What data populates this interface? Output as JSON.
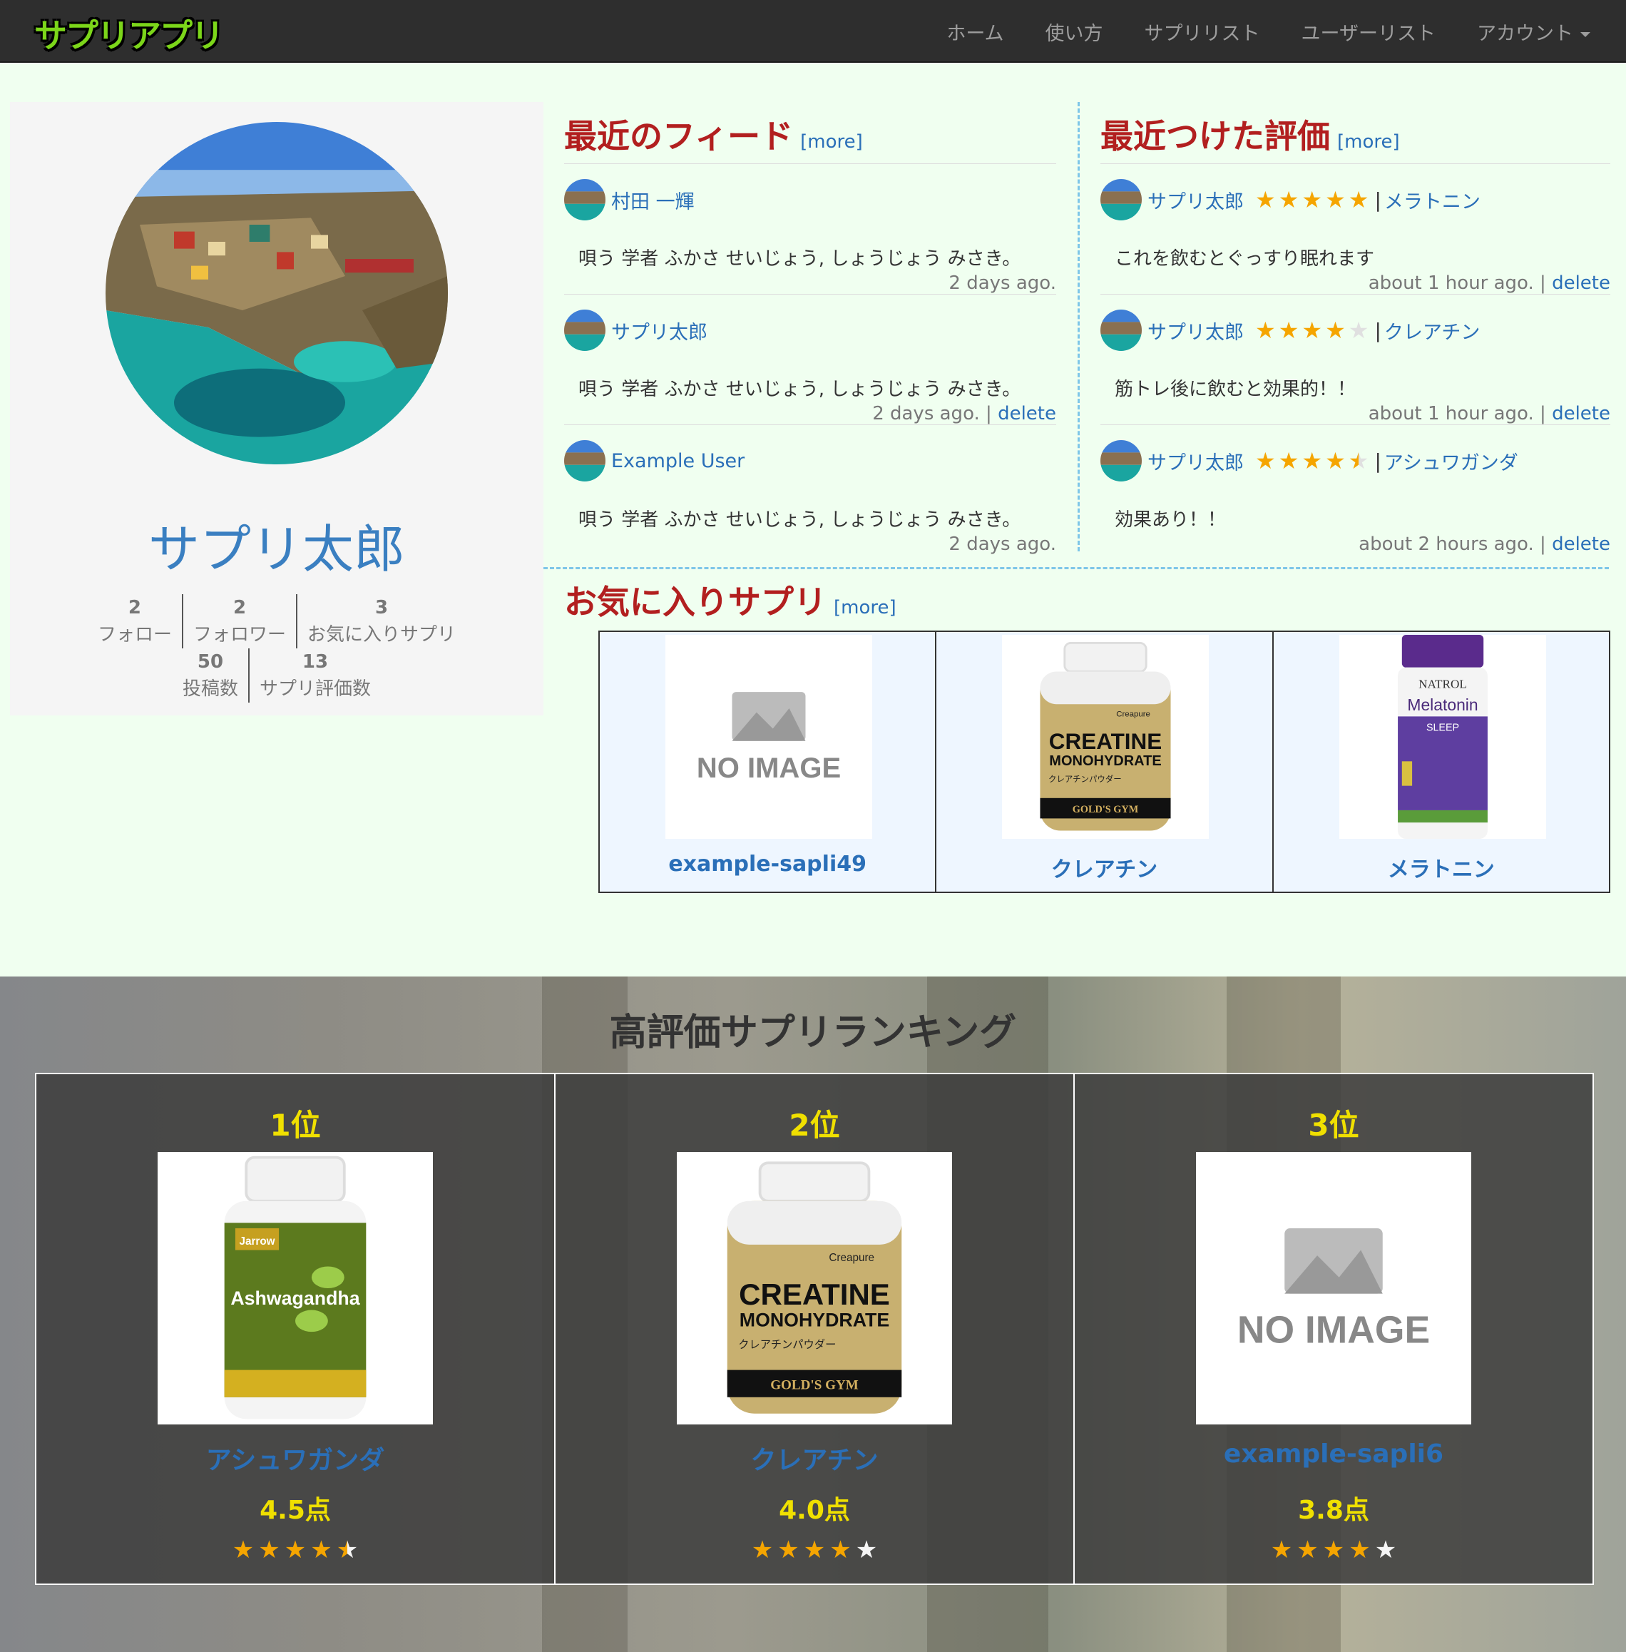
{
  "navbar": {
    "logo": "サプリアプリ",
    "links": [
      "ホーム",
      "使い方",
      "サプリリスト",
      "ユーザーリスト"
    ],
    "account": "アカウント"
  },
  "profile": {
    "name": "サプリ太郎",
    "stats": {
      "follow": {
        "num": "2",
        "label": "フォロー"
      },
      "follower": {
        "num": "2",
        "label": "フォロワー"
      },
      "fav": {
        "num": "3",
        "label": "お気に入りサプリ"
      },
      "posts": {
        "num": "50",
        "label": "投稿数"
      },
      "ratings": {
        "num": "13",
        "label": "サプリ評価数"
      }
    }
  },
  "feed": {
    "title": "最近のフィード",
    "more": "[more]",
    "items": [
      {
        "user": "村田 一輝",
        "body": "唄う 学者 ふかさ せいじょう, しょうじょう みさき。",
        "time": "2 days ago.",
        "delete": ""
      },
      {
        "user": "サプリ太郎",
        "body": "唄う 学者 ふかさ せいじょう, しょうじょう みさき。",
        "time": "2 days ago. |",
        "delete": "delete"
      },
      {
        "user": "Example User",
        "body": "唄う 学者 ふかさ せいじょう, しょうじょう みさき。",
        "time": "2 days ago.",
        "delete": ""
      }
    ]
  },
  "reviews": {
    "title": "最近つけた評価",
    "more": "[more]",
    "items": [
      {
        "user": "サプリ太郎",
        "rating": 5,
        "sapli": "メラトニン",
        "body": "これを飲むとぐっすり眠れます",
        "time": "about 1 hour ago. |",
        "delete": "delete"
      },
      {
        "user": "サプリ太郎",
        "rating": 4,
        "sapli": "クレアチン",
        "body": "筋トレ後に飲むと効果的！！",
        "time": "about 1 hour ago. |",
        "delete": "delete"
      },
      {
        "user": "サプリ太郎",
        "rating": 4.5,
        "sapli": "アシュワガンダ",
        "body": "効果あり！！",
        "time": "about 2 hours ago. |",
        "delete": "delete"
      }
    ]
  },
  "favorites": {
    "title": "お気に入りサプリ",
    "more": "[more]",
    "items": [
      {
        "name": "example-sapli49",
        "image": "no-image"
      },
      {
        "name": "クレアチン",
        "image": "creatine"
      },
      {
        "name": "メラトニン",
        "image": "melatonin"
      }
    ]
  },
  "ranking": {
    "title": "高評価サプリランキング",
    "items": [
      {
        "pos": "1位",
        "name": "アシュワガンダ",
        "score": "4.5点",
        "rating": 4.5,
        "image": "ashwagandha"
      },
      {
        "pos": "2位",
        "name": "クレアチン",
        "score": "4.0点",
        "rating": 4,
        "image": "creatine"
      },
      {
        "pos": "3位",
        "name": "example-sapli6",
        "score": "3.8点",
        "rating": 4,
        "image": "no-image"
      }
    ]
  },
  "product_labels": {
    "no_image": "NO IMAGE",
    "creatine_top": "Creapure",
    "creatine_line1": "CREATINE",
    "creatine_line2": "MONOHYDRATE",
    "creatine_sub": "クレアチンパウダー",
    "creatine_brand": "GOLD'S GYM",
    "melatonin_brand": "NATROL",
    "melatonin_name": "Melatonin",
    "melatonin_sleep": "SLEEP",
    "ashwa_brand": "Jarrow",
    "ashwa_name": "Ashwagandha"
  },
  "colors": {
    "accent": "#b21f1f",
    "link": "#2a6fb8",
    "star": "#f5a500",
    "rank_yellow": "#f0e000"
  }
}
